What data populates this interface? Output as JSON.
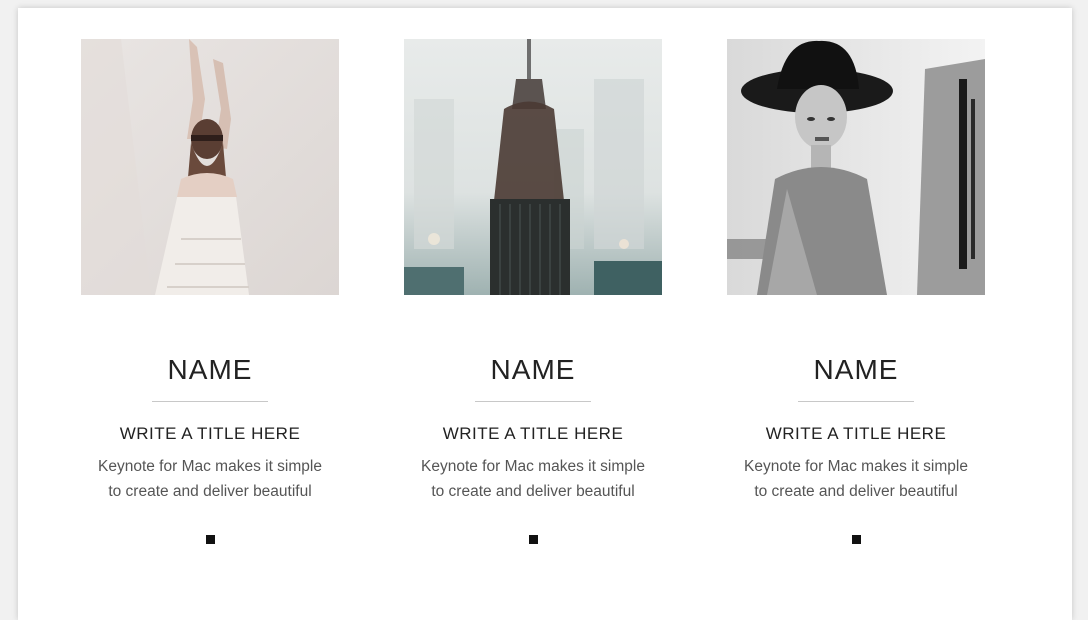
{
  "cards": [
    {
      "name": "NAME",
      "title": "WRITE A TITLE HERE",
      "desc_line1": "Keynote for Mac makes it simple",
      "desc_line2": "to create and deliver beautiful",
      "photo_icon": "woman-arms-raised-photo"
    },
    {
      "name": "NAME",
      "title": "WRITE A TITLE HERE",
      "desc_line1": "Keynote for Mac makes it simple",
      "desc_line2": "to create and deliver beautiful",
      "photo_icon": "city-skyline-double-exposure-photo"
    },
    {
      "name": "NAME",
      "title": "WRITE A TITLE HERE",
      "desc_line1": "Keynote for Mac makes it simple",
      "desc_line2": "to create and deliver beautiful",
      "photo_icon": "woman-with-hat-photo"
    }
  ],
  "colors": {
    "background": "#ffffff",
    "text": "#222222",
    "body_text": "#555555",
    "bullet": "#111111"
  }
}
